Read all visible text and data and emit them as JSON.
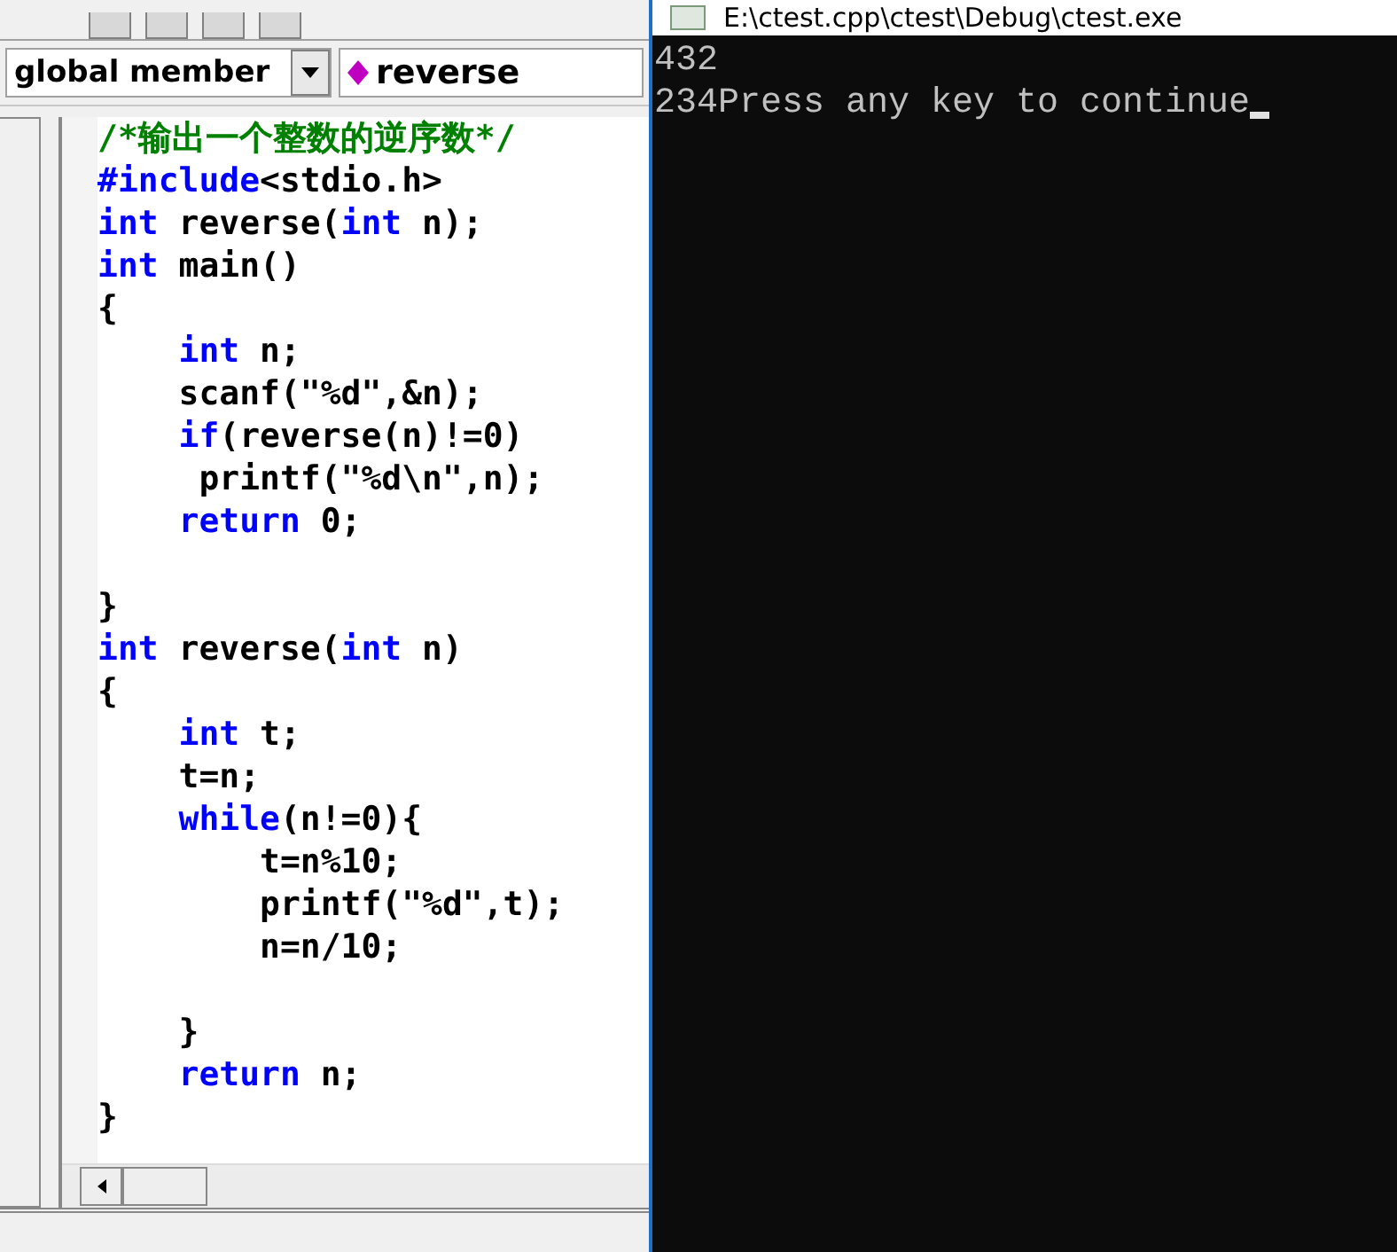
{
  "scope_combo": {
    "value": "global member"
  },
  "member_combo": {
    "value": "reverse"
  },
  "code_lines": [
    {
      "kind": "code",
      "segments": [
        {
          "text": "/*输出一个整数的逆序数*/",
          "kind": "comment"
        }
      ]
    },
    {
      "kind": "code",
      "segments": [
        {
          "text": "#include",
          "kind": "keyword"
        },
        {
          "text": "<stdio.h>",
          "kind": "plain"
        }
      ]
    },
    {
      "kind": "code",
      "segments": [
        {
          "text": "int",
          "kind": "keyword"
        },
        {
          "text": " reverse(",
          "kind": "plain"
        },
        {
          "text": "int",
          "kind": "keyword"
        },
        {
          "text": " n);",
          "kind": "plain"
        }
      ]
    },
    {
      "kind": "code",
      "segments": [
        {
          "text": "int",
          "kind": "keyword"
        },
        {
          "text": " main()",
          "kind": "plain"
        }
      ]
    },
    {
      "kind": "code",
      "segments": [
        {
          "text": "{",
          "kind": "plain"
        }
      ]
    },
    {
      "kind": "code",
      "segments": [
        {
          "text": "    int",
          "kind": "keyword"
        },
        {
          "text": " n;",
          "kind": "plain"
        }
      ]
    },
    {
      "kind": "code",
      "segments": [
        {
          "text": "    scanf(\"%d\",&n);",
          "kind": "plain"
        }
      ]
    },
    {
      "kind": "code",
      "segments": [
        {
          "text": "    if",
          "kind": "keyword"
        },
        {
          "text": "(reverse(n)!=0)",
          "kind": "plain"
        }
      ]
    },
    {
      "kind": "code",
      "segments": [
        {
          "text": "     printf(\"%d\\n\",n);",
          "kind": "plain"
        }
      ]
    },
    {
      "kind": "code",
      "segments": [
        {
          "text": "    return",
          "kind": "keyword"
        },
        {
          "text": " 0;",
          "kind": "plain"
        }
      ]
    },
    {
      "kind": "blank"
    },
    {
      "kind": "code",
      "segments": [
        {
          "text": "}",
          "kind": "plain"
        }
      ]
    },
    {
      "kind": "code",
      "segments": [
        {
          "text": "int",
          "kind": "keyword"
        },
        {
          "text": " reverse(",
          "kind": "plain"
        },
        {
          "text": "int",
          "kind": "keyword"
        },
        {
          "text": " n)",
          "kind": "plain"
        }
      ]
    },
    {
      "kind": "code",
      "segments": [
        {
          "text": "{",
          "kind": "plain"
        }
      ]
    },
    {
      "kind": "code",
      "segments": [
        {
          "text": "    int",
          "kind": "keyword"
        },
        {
          "text": " t;",
          "kind": "plain"
        }
      ]
    },
    {
      "kind": "code",
      "segments": [
        {
          "text": "    t=n;",
          "kind": "plain"
        }
      ]
    },
    {
      "kind": "code",
      "segments": [
        {
          "text": "    while",
          "kind": "keyword"
        },
        {
          "text": "(n!=0){",
          "kind": "plain"
        }
      ]
    },
    {
      "kind": "code",
      "segments": [
        {
          "text": "        t=n%10;",
          "kind": "plain"
        }
      ]
    },
    {
      "kind": "code",
      "segments": [
        {
          "text": "        printf(\"%d\",t);",
          "kind": "plain"
        }
      ]
    },
    {
      "kind": "code",
      "segments": [
        {
          "text": "        n=n/10;",
          "kind": "plain"
        }
      ]
    },
    {
      "kind": "blank"
    },
    {
      "kind": "code",
      "segments": [
        {
          "text": "    }",
          "kind": "plain"
        }
      ]
    },
    {
      "kind": "code",
      "segments": [
        {
          "text": "    return",
          "kind": "keyword"
        },
        {
          "text": " n;",
          "kind": "plain"
        }
      ]
    },
    {
      "kind": "code",
      "segments": [
        {
          "text": "}",
          "kind": "plain"
        }
      ]
    }
  ],
  "console": {
    "title": "E:\\ctest.cpp\\ctest\\Debug\\ctest.exe",
    "lines": [
      "432",
      "234Press any key to continue"
    ],
    "cursor": true
  }
}
